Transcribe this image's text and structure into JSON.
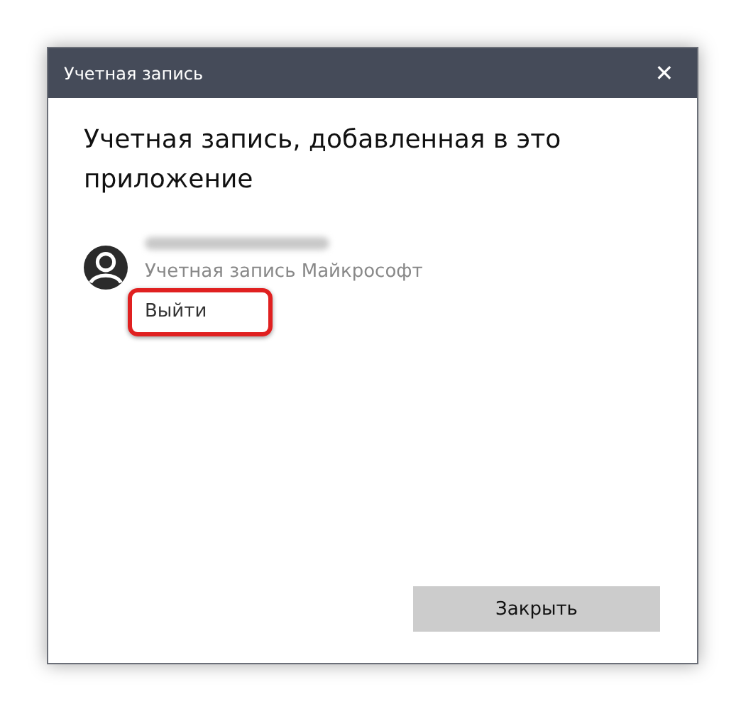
{
  "window": {
    "title": "Учетная запись",
    "close_glyph": "✕"
  },
  "heading": "Учетная запись, добавленная в это приложение",
  "account": {
    "type": "Учетная запись Майкрософт",
    "sign_out": "Выйти",
    "highlighted": true
  },
  "buttons": [
    "Закрыть"
  ]
}
